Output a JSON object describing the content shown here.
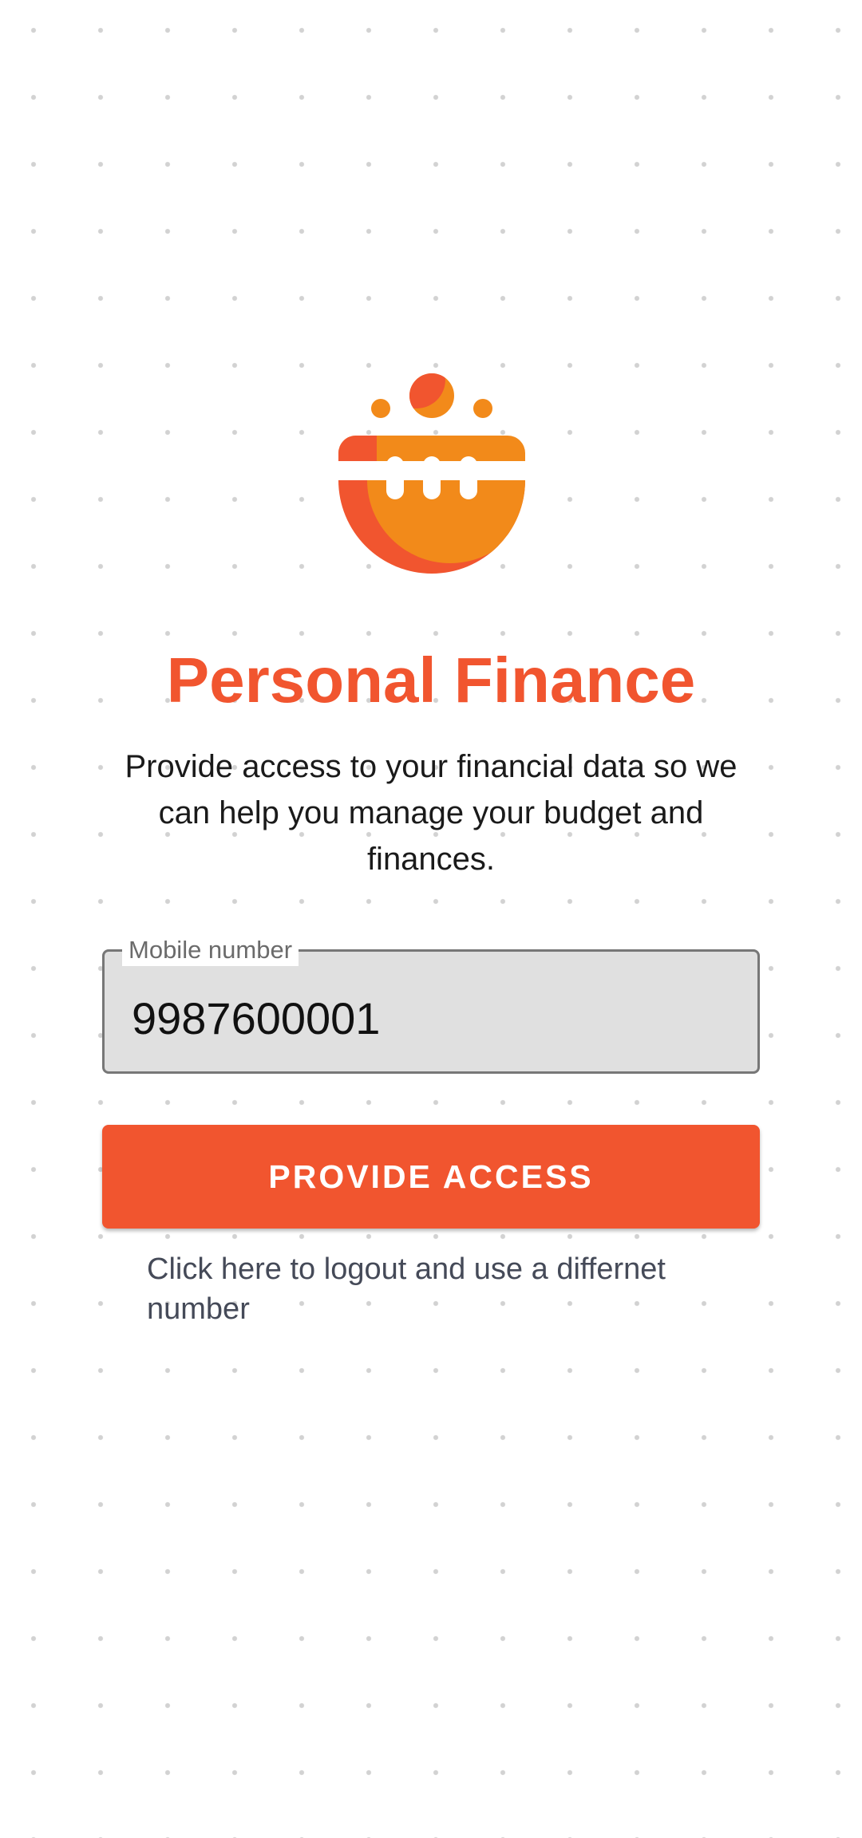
{
  "app": {
    "logo_icon": "finance-pot-icon",
    "brand_color": "#f1552f",
    "logo_colors": {
      "primary": "#f1552f",
      "secondary": "#f28a1a"
    }
  },
  "header": {
    "title": "Personal Finance",
    "description": "Provide access to your financial data so we can help you manage your budget and finances."
  },
  "form": {
    "mobile_label": "Mobile number",
    "mobile_value": "9987600001",
    "submit_label": "PROVIDE ACCESS",
    "logout_text": "Click here to logout and use a differnet number"
  }
}
